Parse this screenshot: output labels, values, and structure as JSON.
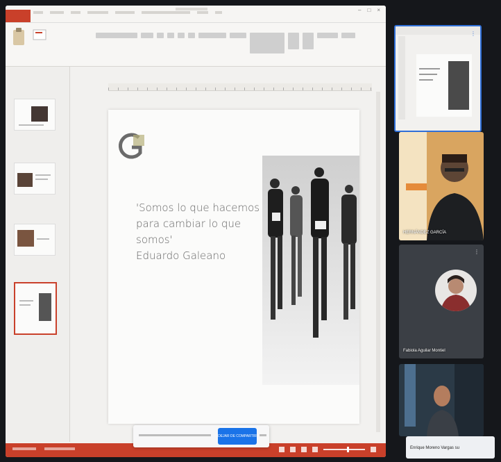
{
  "colors": {
    "accent": "#c9402a",
    "share_button": "#1a73e8",
    "active_tile_border": "#2f6fd8"
  },
  "slide": {
    "quote_lines": [
      "'Somos lo que hacemos",
      "para cambiar lo que",
      "somos'",
      "Eduardo Galeano"
    ]
  },
  "share_bar": {
    "stop_label": "DEJAR DE COMPARTIR"
  },
  "participants": [
    {
      "name": ""
    },
    {
      "name": "HERNÁNDEZ GARCÍA"
    },
    {
      "name": "Fabiola Aguilar Montiel"
    },
    {
      "name": ""
    },
    {
      "name": "Enrique Moreno Vargas su"
    }
  ],
  "icons": {
    "more": "more-vert-icon",
    "logo": "g-logo-icon"
  }
}
